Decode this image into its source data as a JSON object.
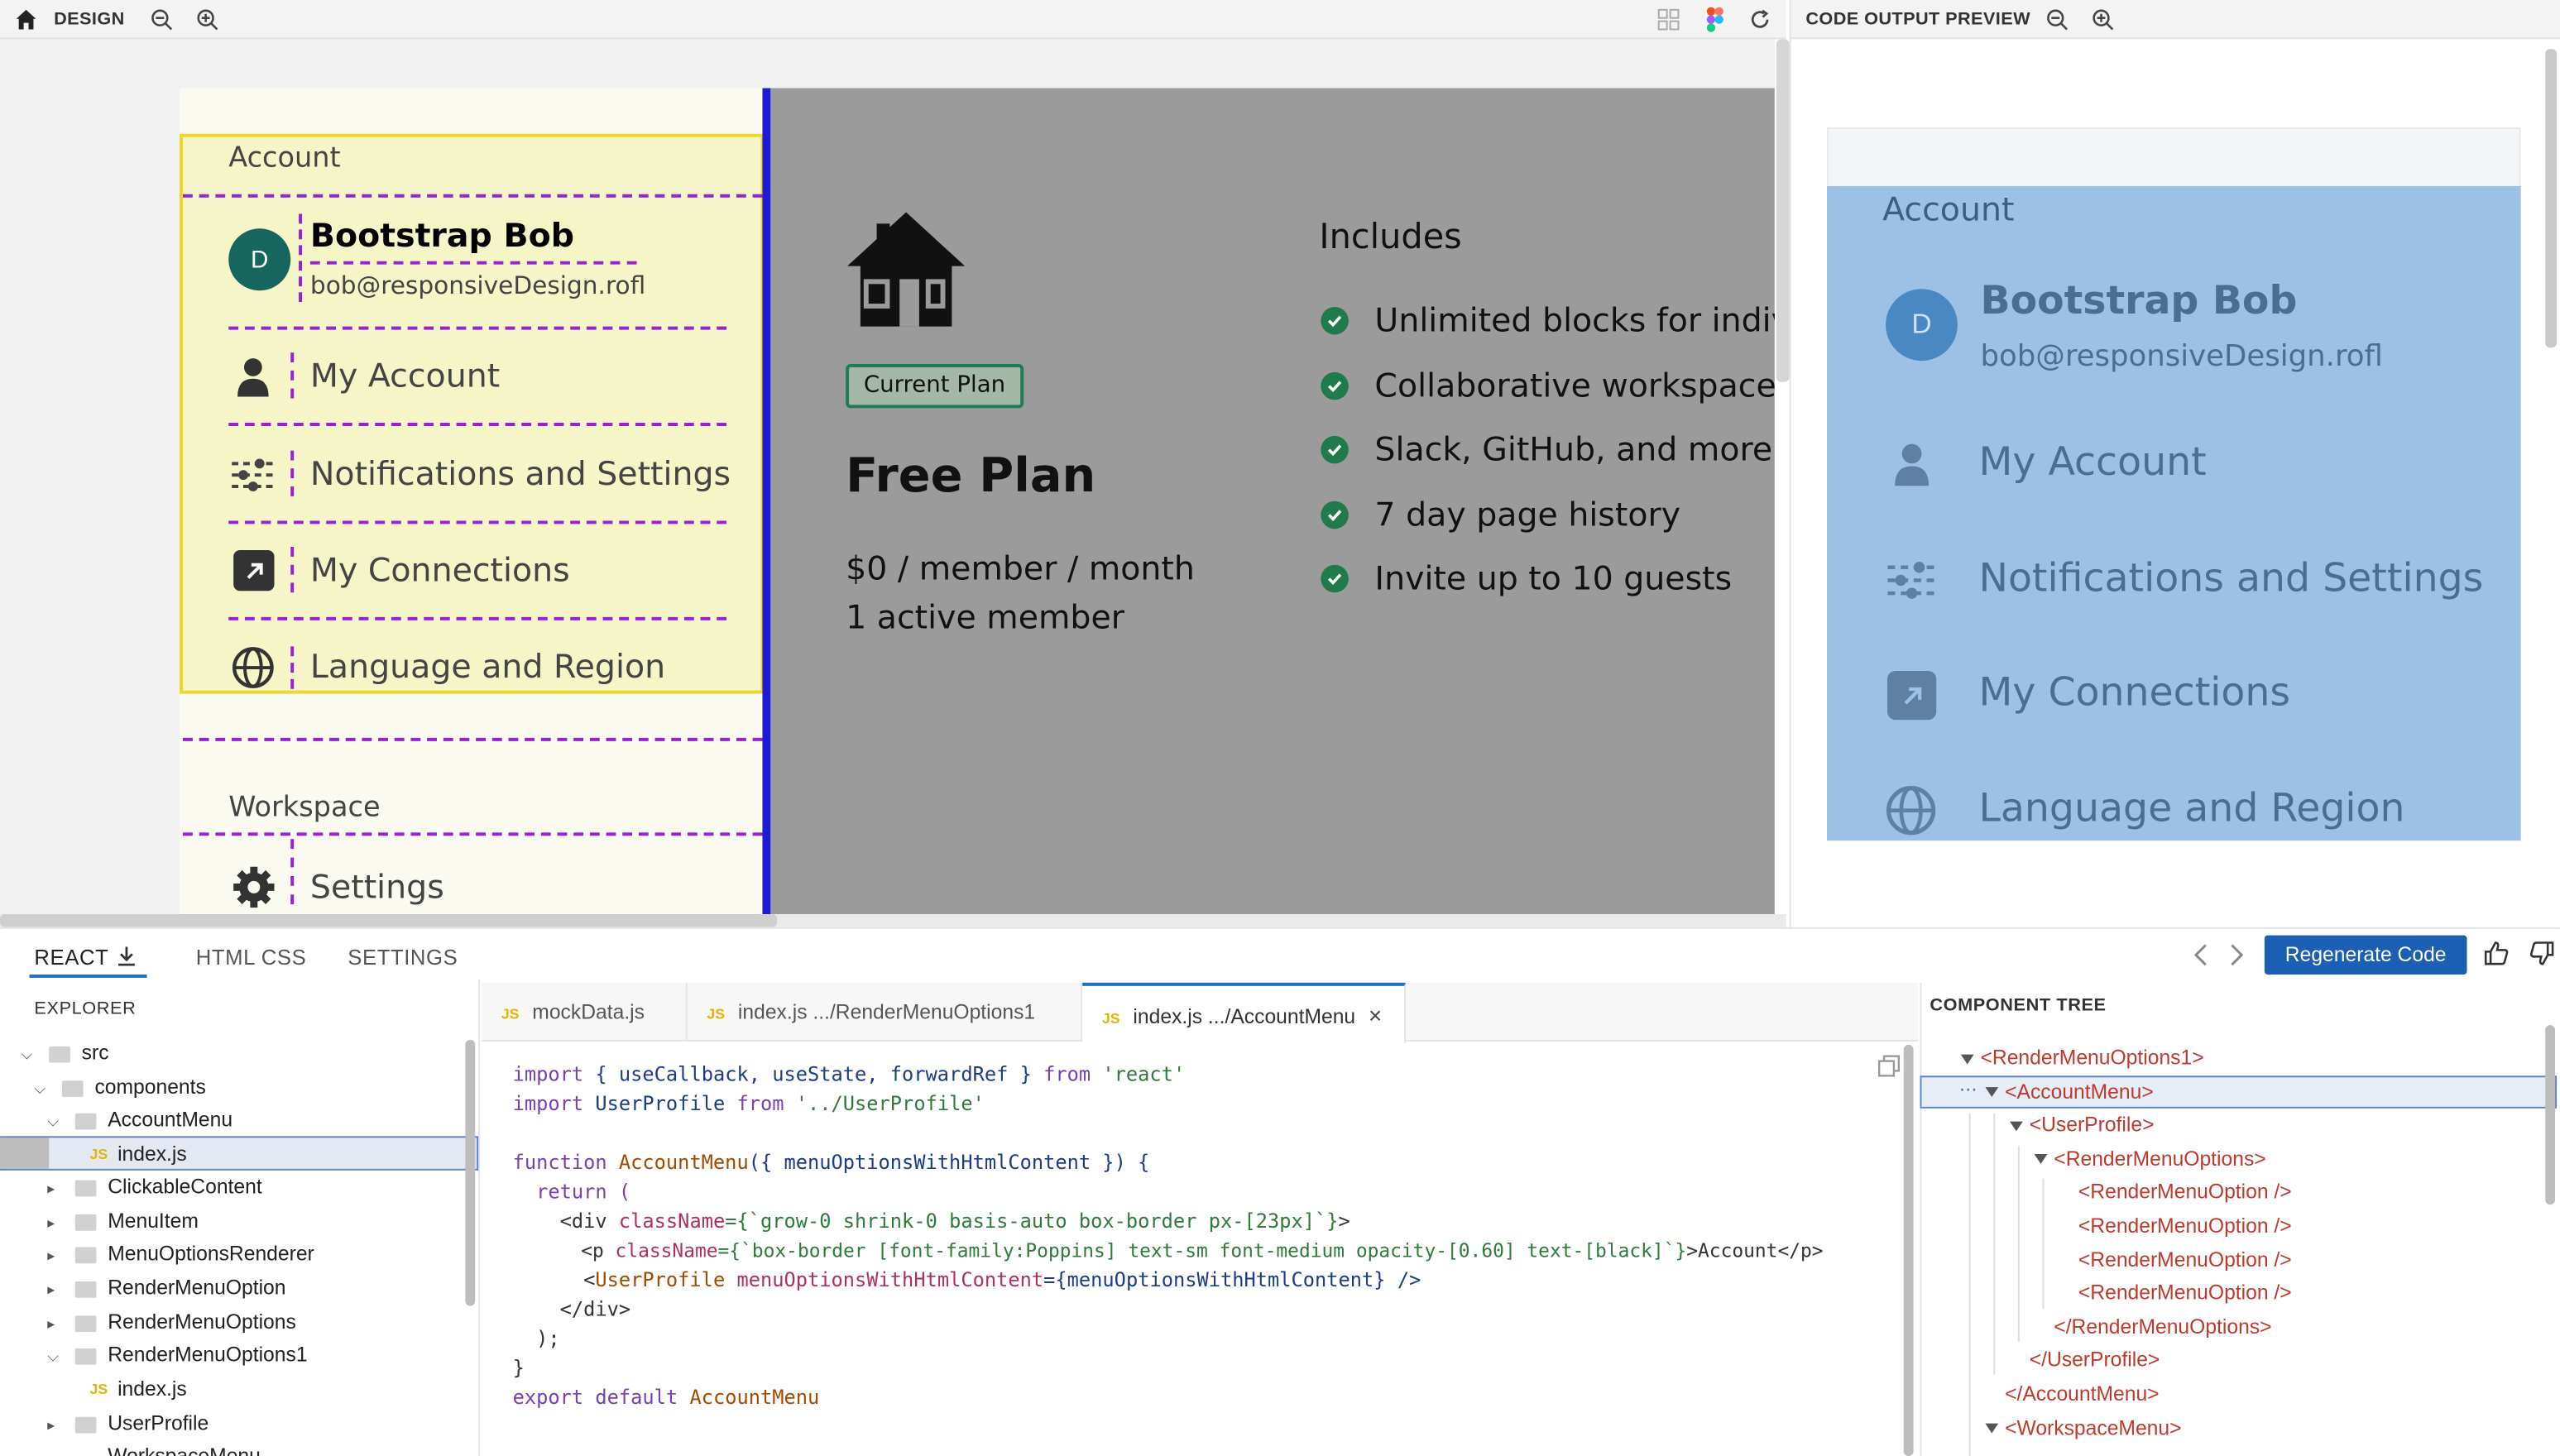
{
  "topbar": {
    "design_label": "DESIGN",
    "preview_label": "CODE OUTPUT PREVIEW"
  },
  "design": {
    "account_section": "Account",
    "user": {
      "initial": "D",
      "name": "Bootstrap Bob",
      "email": "bob@responsiveDesign.rofl"
    },
    "menu_items": [
      "My Account",
      "Notifications and Settings",
      "My Connections",
      "Language and Region"
    ],
    "workspace_section": "Workspace",
    "settings_item": "Settings",
    "plan": {
      "badge": "Current Plan",
      "title": "Free Plan",
      "price": "$0 / member / month",
      "members": "1 active member",
      "includes_title": "Includes",
      "includes": [
        "Unlimited blocks for indiv",
        "Collaborative workspace",
        "Slack, GitHub, and more i",
        "7 day page history",
        "Invite up to 10 guests"
      ]
    }
  },
  "preview": {
    "account_section": "Account",
    "user": {
      "initial": "D",
      "name": "Bootstrap Bob",
      "email": "bob@responsiveDesign.rofl"
    },
    "menu_items": [
      "My Account",
      "Notifications and Settings",
      "My Connections",
      "Language and Region"
    ]
  },
  "bottom_tabs": {
    "react": "REACT",
    "html_css": "HTML CSS",
    "settings": "SETTINGS",
    "regenerate": "Regenerate Code"
  },
  "explorer": {
    "title": "EXPLORER",
    "items": [
      "src",
      "components",
      "AccountMenu",
      "index.js",
      "ClickableContent",
      "MenuItem",
      "MenuOptionsRenderer",
      "RenderMenuOption",
      "RenderMenuOptions",
      "RenderMenuOptions1",
      "index.js",
      "UserProfile",
      "WorkspaceMenu"
    ]
  },
  "editor": {
    "tabs": [
      "mockData.js",
      "index.js .../RenderMenuOptions1",
      "index.js .../AccountMenu"
    ],
    "js_badge": "JS",
    "code": {
      "l1_kw": "import",
      "l1_mid": " { useCallback, useState, forwardRef } ",
      "l1_from": "from",
      "l1_str": " 'react'",
      "l2_kw": "import",
      "l2_mid": " UserProfile ",
      "l2_from": "from",
      "l2_str": " '../UserProfile'",
      "l4_kw": "function",
      "l4_fn": " AccountMenu",
      "l4_rest": "({ menuOptionsWithHtmlContent }) {",
      "l5": "  return (",
      "l6_a": "    <div ",
      "l6_attr": "className",
      "l6_str": "={`grow-0 shrink-0 basis-auto box-border px-[23px]`}",
      "l6_b": ">",
      "l7_a": "      <p ",
      "l7_attr": "className",
      "l7_str": "={`box-border [font-family:Poppins] text-sm font-medium opacity-[0.60] text-[black]`}",
      "l7_b": ">Account</p>",
      "l8_a": "      <",
      "l8_tag": "UserProfile",
      "l8_attr": " menuOptionsWithHtmlContent",
      "l8_b": "={menuOptionsWithHtmlContent} />",
      "l9": "    </div>",
      "l10": "  );",
      "l11": "}",
      "l12_kw": "export default",
      "l12_fn": " AccountMenu"
    }
  },
  "component_tree": {
    "title": "COMPONENT TREE",
    "nodes": [
      "<RenderMenuOptions1>",
      "<AccountMenu>",
      "<UserProfile>",
      "<RenderMenuOptions>",
      "<RenderMenuOption />",
      "<RenderMenuOption />",
      "<RenderMenuOption />",
      "<RenderMenuOption />",
      "</RenderMenuOptions>",
      "</UserProfile>",
      "</AccountMenu>",
      "<WorkspaceMenu>"
    ]
  }
}
